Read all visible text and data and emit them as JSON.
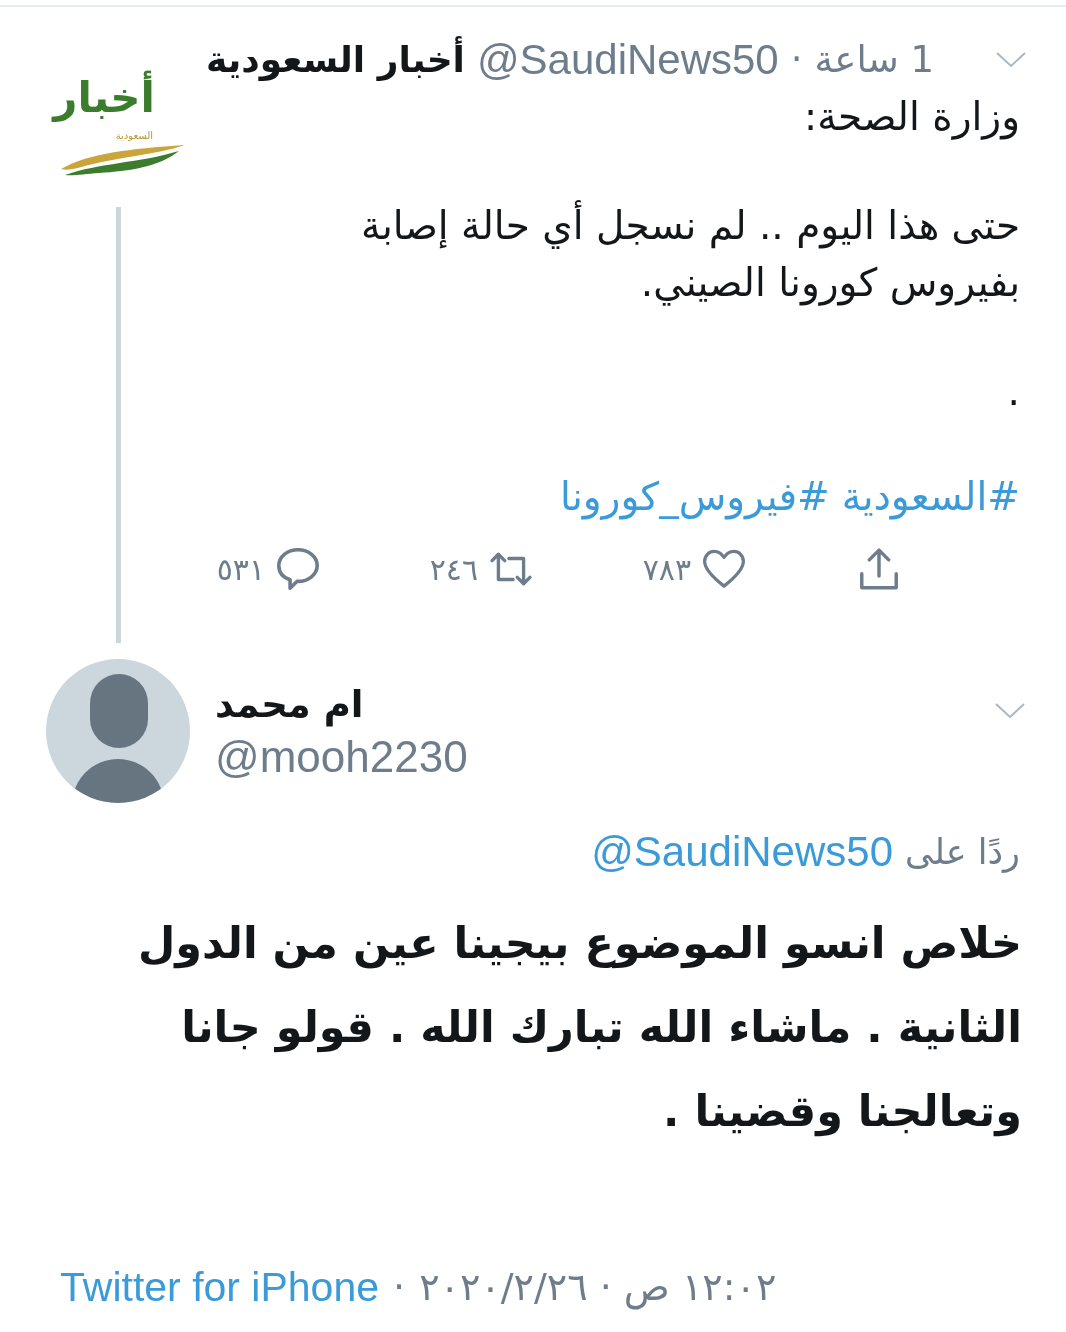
{
  "tweet": {
    "author": {
      "logo": {
        "title": "أخبار",
        "subtitle": "السعودية"
      },
      "name": "أخبار السعودية",
      "handle": "@SaudiNews50",
      "separator": "·",
      "time": "1 ساعة"
    },
    "paragraphs": [
      "وزارة الصحة:",
      "حتى هذا اليوم .. لم نسجل أي حالة إصابة بفيروس كورونا الصيني.",
      "."
    ],
    "hashtags": [
      "#السعودية",
      "#فيروس_كورونا"
    ],
    "actions": [
      {
        "kind": "share"
      },
      {
        "kind": "like",
        "count": "٧٨٣"
      },
      {
        "kind": "retweet",
        "count": "٢٤٦"
      },
      {
        "kind": "reply",
        "count": "٥٣١"
      }
    ]
  },
  "reply": {
    "author": {
      "name": "ام محمد",
      "handle": "@mooh2230"
    },
    "replying_to": {
      "label": "ردًا على",
      "handle": "@SaudiNews50"
    },
    "text": "خلاص انسو الموضوع بيجينا عين من الدول الثانية . ماشاء الله تبارك الله . قولو جانا وتعالجنا وقضينا .",
    "footer": {
      "timestamp": "١٢:٠٢ ص · ٢٠٢٠/٢/٢٦",
      "separator": "·",
      "source": "Twitter for iPhone"
    }
  }
}
